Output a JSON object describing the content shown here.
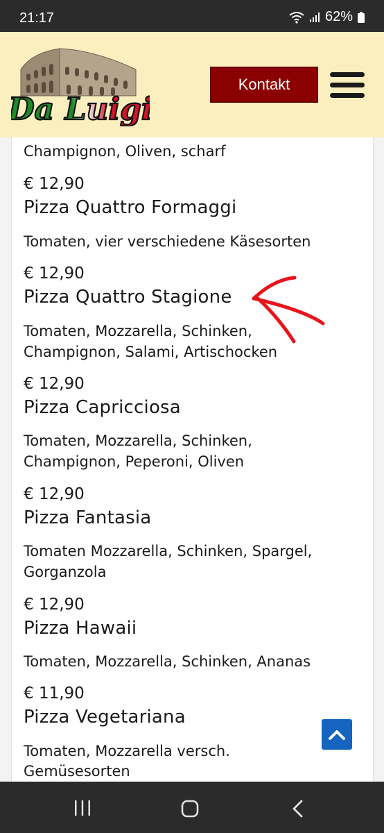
{
  "status": {
    "time": "21:17",
    "battery": "62%"
  },
  "header": {
    "logo_text": "Da Luigi",
    "contact_label": "Kontakt"
  },
  "menu": [
    {
      "desc": "Champignon, Oliven, scharf"
    },
    {
      "price": "€ 12,90",
      "name": "Pizza Quattro Formaggi",
      "desc": "Tomaten, vier verschiedene Käsesorten"
    },
    {
      "price": "€ 12,90",
      "name": "Pizza Quattro Stagione",
      "desc1": "Tomaten, Mozzarella, Schinken,",
      "desc2": "Champignon, Salami, Artischocken"
    },
    {
      "price": "€ 12,90",
      "name": "Pizza Capricciosa",
      "desc1": "Tomaten, Mozzarella, Schinken,",
      "desc2": "Champignon, Peperoni, Oliven"
    },
    {
      "price": "€ 12,90",
      "name": "Pizza Fantasia",
      "desc1": "Tomaten Mozzarella, Schinken, Spargel,",
      "desc2": "Gorganzola"
    },
    {
      "price": "€ 12,90",
      "name": "Pizza Hawaii",
      "desc": "Tomaten, Mozzarella, Schinken, Ananas"
    },
    {
      "price": "€ 11,90",
      "name": "Pizza Vegetariana",
      "desc1": "Tomaten, Mozzarella versch.",
      "desc2": "Gemüsesorten"
    }
  ],
  "colors": {
    "header_bg": "#fbefc0",
    "button_bg": "#8b0000",
    "annotation": "#e8141c",
    "to_top_bg": "#1565c0"
  }
}
